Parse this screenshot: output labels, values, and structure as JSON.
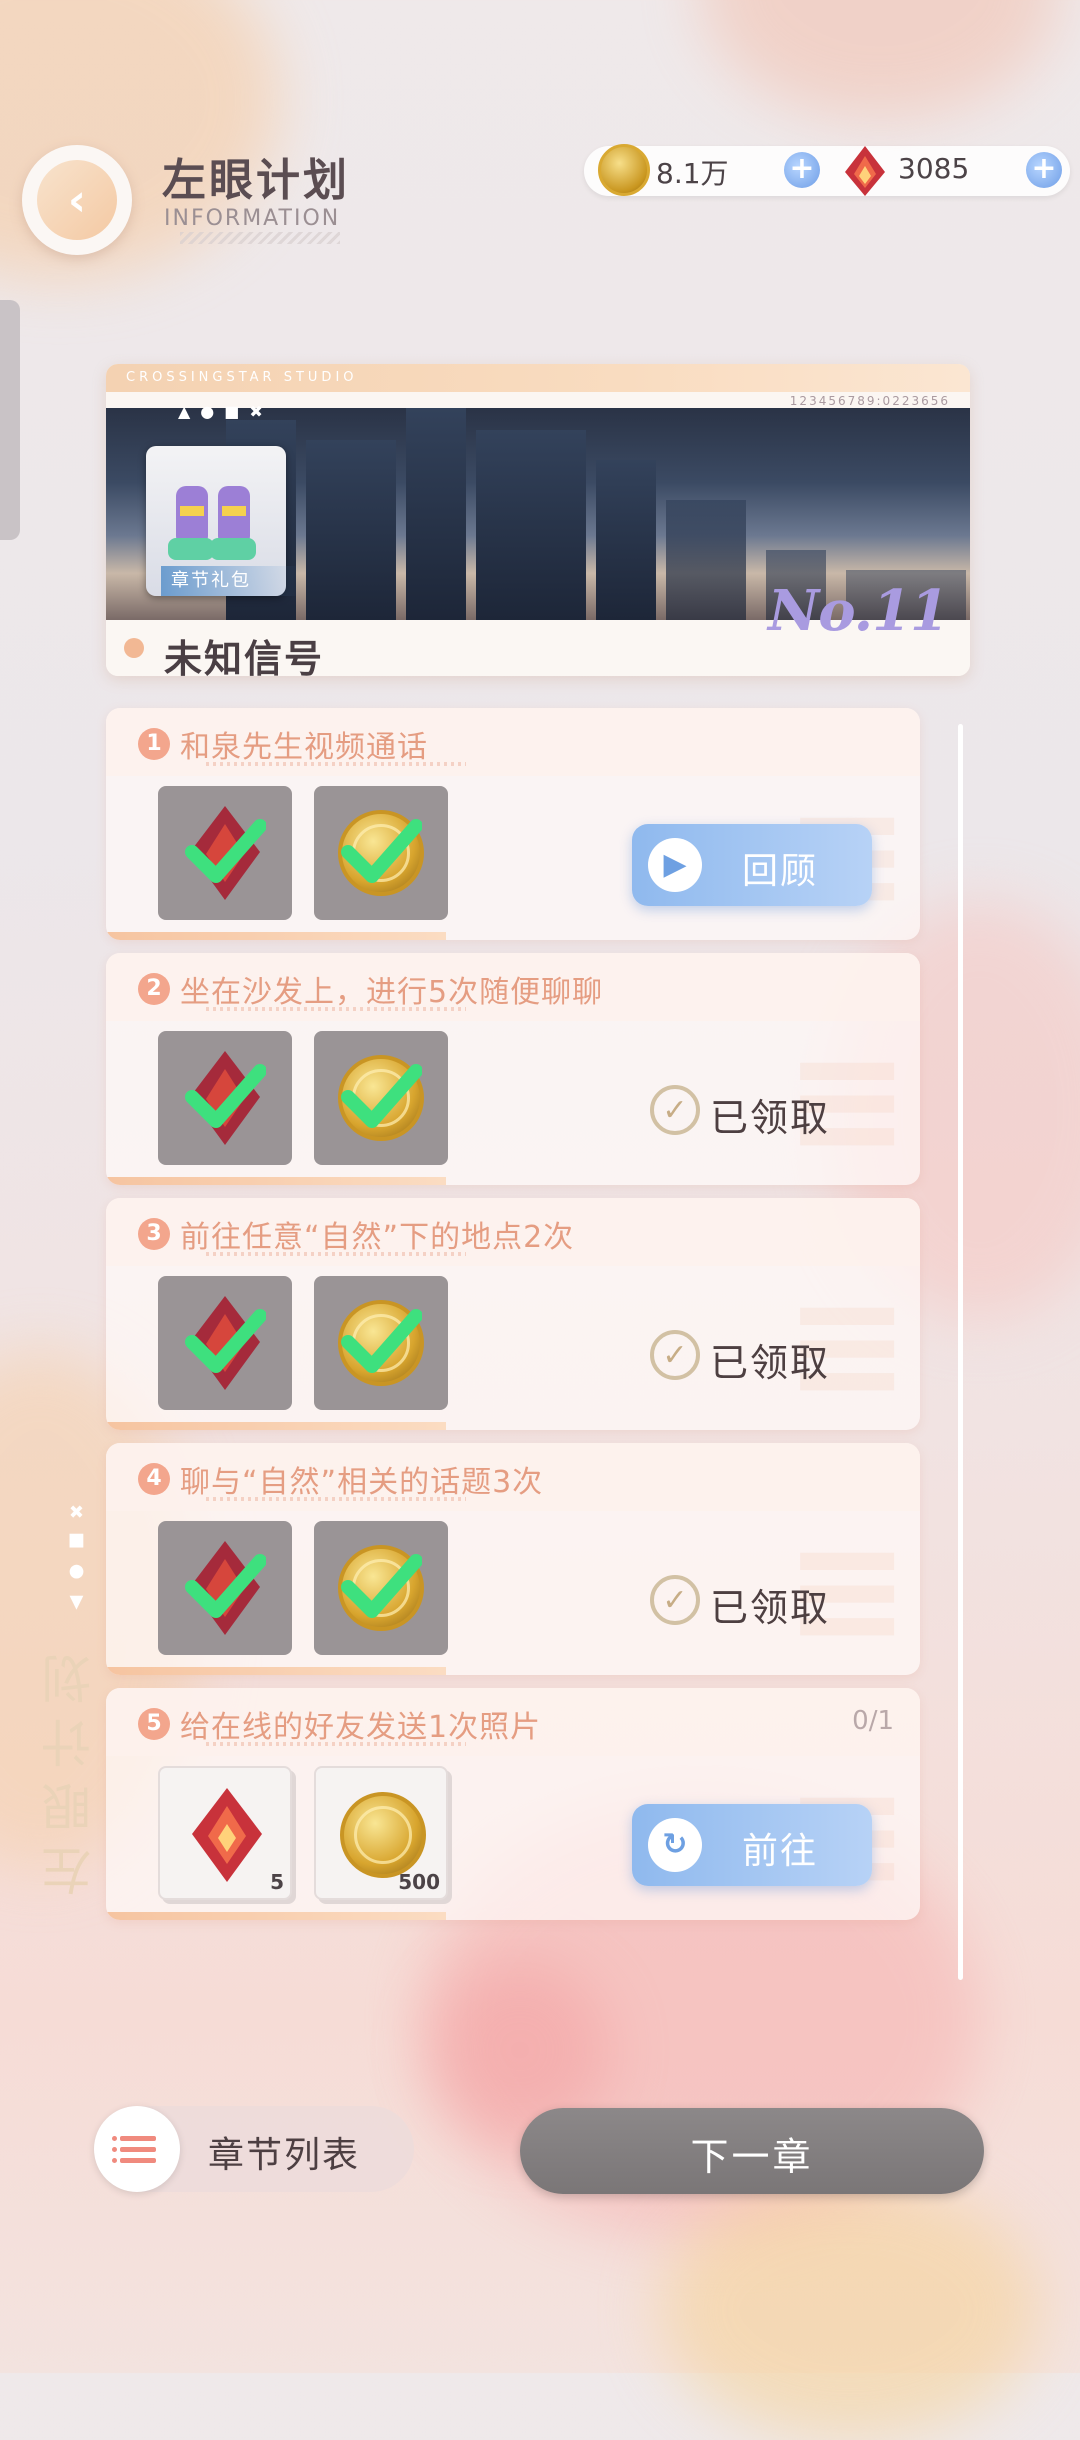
{
  "header": {
    "title": "左眼计划",
    "subtitle": "INFORMATION",
    "coins": "8.1万",
    "gems": "3085"
  },
  "banner": {
    "studio": "CROSSINGSTAR STUDIO",
    "serial": "123456789:0223656",
    "marks": "▲●■✖",
    "pack_label": "章节礼包",
    "chapter_name": "未知信号",
    "chapter_no": "No.11"
  },
  "tasks": [
    {
      "num": "1",
      "title": "和泉先生视频通话",
      "state": "done",
      "action": "回顾"
    },
    {
      "num": "2",
      "title": "坐在沙发上，进行5次随便聊聊",
      "state": "claimed",
      "action": "已领取"
    },
    {
      "num": "3",
      "title": "前往任意“自然”下的地点2次",
      "state": "claimed",
      "action": "已领取"
    },
    {
      "num": "4",
      "title": "聊与“自然”相关的话题3次",
      "state": "claimed",
      "action": "已领取"
    },
    {
      "num": "5",
      "title": "给在线的好友发送1次照片",
      "state": "open",
      "progress": "0/1",
      "action": "前往",
      "reward1_qty": "5",
      "reward2_qty": "500"
    }
  ],
  "side_text": "左眼计划",
  "footer": {
    "list_label": "章节列表",
    "next_label": "下一章"
  },
  "colors": {
    "accent": "#f3a68d",
    "button_blue": "#8fb9ee"
  }
}
